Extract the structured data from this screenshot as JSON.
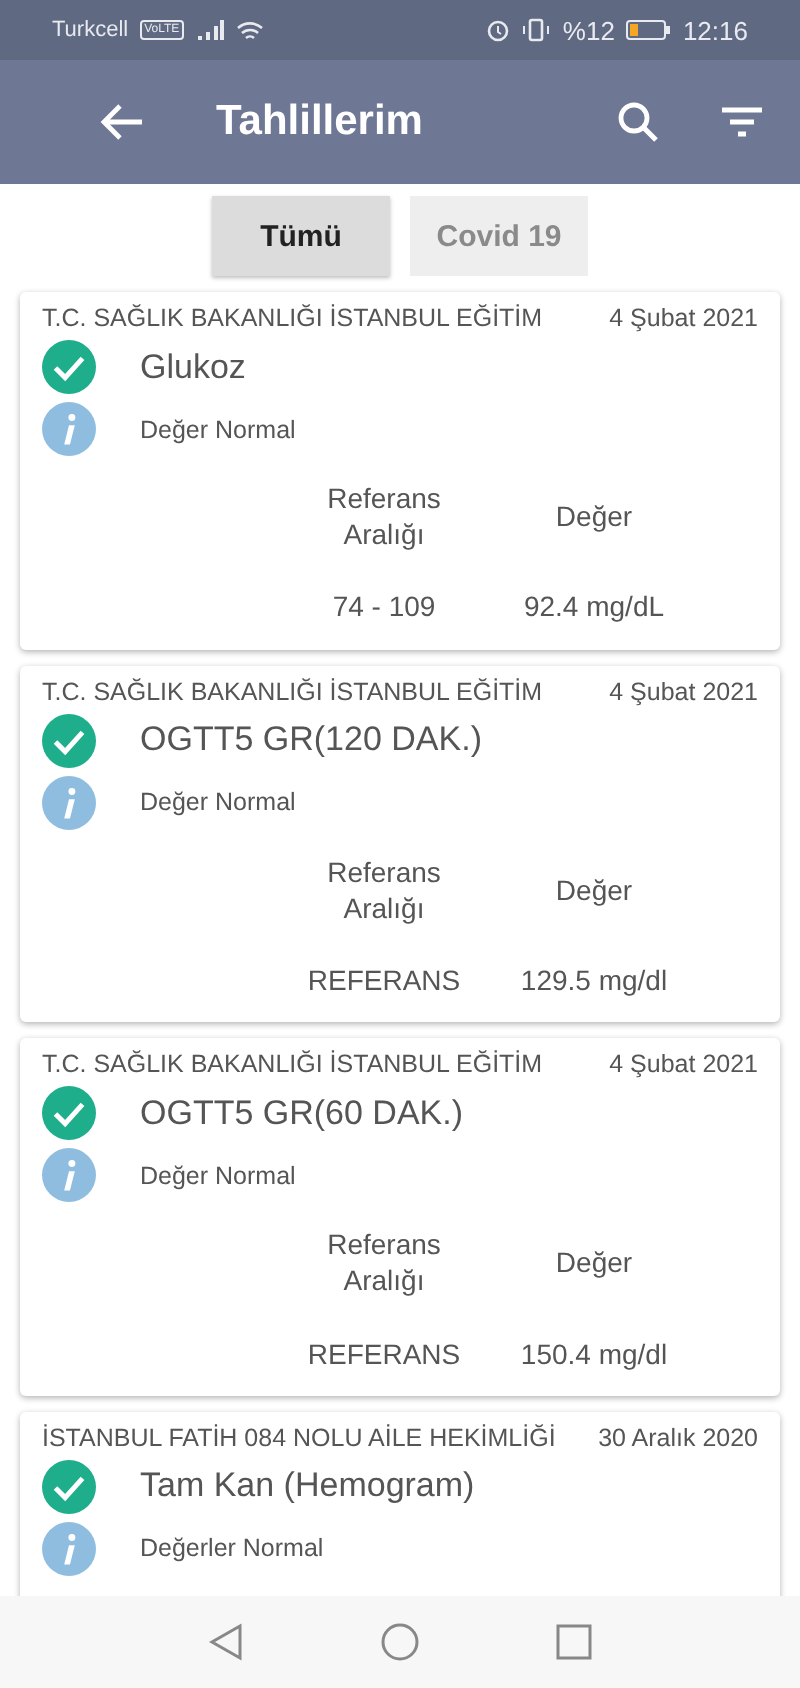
{
  "status_bar": {
    "carrier": "Turkcell",
    "network_badge": "VoLTE",
    "battery": "%12",
    "time": "12:16"
  },
  "app_bar": {
    "title": "Tahlillerim"
  },
  "tabs": [
    {
      "label": "Tümü",
      "selected": true
    },
    {
      "label": "Covid 19",
      "selected": false
    }
  ],
  "results": [
    {
      "institution": "T.C. SAĞLIK BAKANLIĞI İSTANBUL EĞİTİM",
      "date": "4 Şubat 2021",
      "test": "Glukoz",
      "status": "Değer Normal",
      "table": {
        "ref_header": "Referans Aralığı",
        "value_header": "Değer",
        "ref": "74 - 109",
        "value": "92.4 mg/dL"
      }
    },
    {
      "institution": "T.C. SAĞLIK BAKANLIĞI İSTANBUL EĞİTİM",
      "date": "4 Şubat 2021",
      "test": "OGTT5 GR(120 DAK.)",
      "status": "Değer Normal",
      "table": {
        "ref_header": "Referans Aralığı",
        "value_header": "Değer",
        "ref": "REFERANS",
        "value": "129.5 mg/dl"
      }
    },
    {
      "institution": "T.C. SAĞLIK BAKANLIĞI İSTANBUL EĞİTİM",
      "date": "4 Şubat 2021",
      "test": "OGTT5 GR(60 DAK.)",
      "status": "Değer Normal",
      "table": {
        "ref_header": "Referans Aralığı",
        "value_header": "Değer",
        "ref": "REFERANS",
        "value": "150.4 mg/dl"
      }
    },
    {
      "institution": "İSTANBUL FATİH 084 NOLU AİLE HEKİMLİĞİ",
      "date": "30 Aralık 2020",
      "test": "Tam Kan (Hemogram)",
      "status": "Değerler Normal"
    }
  ]
}
